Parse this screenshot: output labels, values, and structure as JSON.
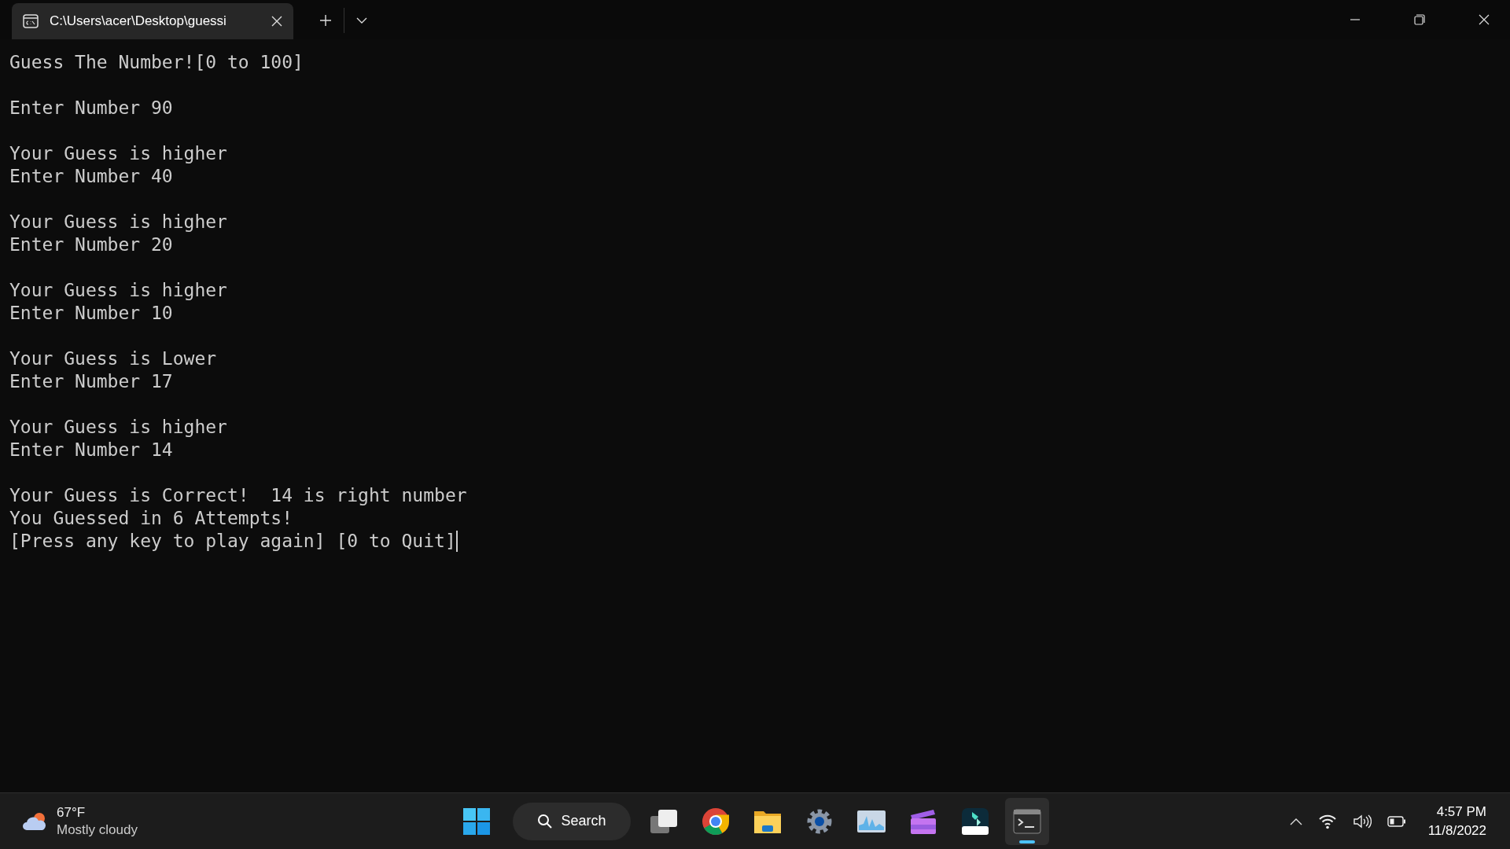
{
  "window": {
    "tab": {
      "title": "C:\\Users\\acer\\Desktop\\guessi",
      "selected": true
    }
  },
  "console": {
    "blocks": [
      [
        "Guess The Number![0 to 100]"
      ],
      [
        "Enter Number 90"
      ],
      [
        "Your Guess is higher",
        "Enter Number 40"
      ],
      [
        "Your Guess is higher",
        "Enter Number 20"
      ],
      [
        "Your Guess is higher",
        "Enter Number 10"
      ],
      [
        "Your Guess is Lower",
        "Enter Number 17"
      ],
      [
        "Your Guess is higher",
        "Enter Number 14"
      ],
      [
        "Your Guess is Correct!  14 is right number",
        "You Guessed in 6 Attempts!",
        "[Press any key to play again] [0 to Quit]"
      ]
    ]
  },
  "taskbar": {
    "weather": {
      "temperature": "67°F",
      "condition": "Mostly cloudy"
    },
    "search": {
      "label": "Search"
    },
    "apps": [
      {
        "kind": "taskview",
        "selected": false
      },
      {
        "kind": "chrome",
        "selected": false
      },
      {
        "kind": "folder",
        "selected": false
      },
      {
        "kind": "settings",
        "selected": false
      },
      {
        "kind": "monitor",
        "selected": false
      },
      {
        "kind": "clapper",
        "selected": false
      },
      {
        "kind": "editor",
        "selected": false
      },
      {
        "kind": "terminal",
        "selected": true
      }
    ],
    "clock": {
      "time": "4:57 PM",
      "date": "11/8/2022"
    }
  }
}
